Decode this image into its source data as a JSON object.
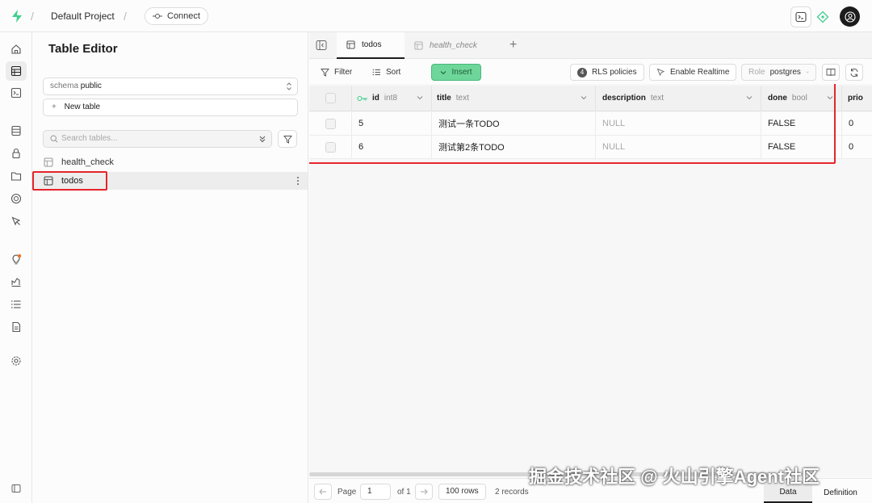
{
  "topbar": {
    "project_name": "Default Project",
    "connect_label": "Connect"
  },
  "sidebar": {
    "title": "Table Editor",
    "schema_prefix": "schema",
    "schema_value": "public",
    "new_table_label": "New table",
    "search_placeholder": "Search tables...",
    "tables": [
      {
        "name": "health_check",
        "selected": false
      },
      {
        "name": "todos",
        "selected": true
      }
    ]
  },
  "tabs": [
    {
      "label": "todos",
      "active": true
    },
    {
      "label": "health_check",
      "active": false
    }
  ],
  "toolbar": {
    "filter_label": "Filter",
    "sort_label": "Sort",
    "insert_label": "Insert",
    "rls_count": "4",
    "rls_label": "RLS policies",
    "realtime_label": "Enable Realtime",
    "role_prefix": "Role",
    "role_value": "postgres"
  },
  "grid": {
    "columns": [
      {
        "name": "id",
        "type": "int8"
      },
      {
        "name": "title",
        "type": "text"
      },
      {
        "name": "description",
        "type": "text"
      },
      {
        "name": "done",
        "type": "bool"
      },
      {
        "name": "prio",
        "type": ""
      }
    ],
    "rows": [
      {
        "id": "5",
        "title": "测试一条TODO",
        "description": "NULL",
        "done": "FALSE",
        "prio": "0"
      },
      {
        "id": "6",
        "title": "测试第2条TODO",
        "description": "NULL",
        "done": "FALSE",
        "prio": "0"
      }
    ]
  },
  "footer": {
    "page_label": "Page",
    "page_value": "1",
    "of_label": "of 1",
    "rows_label": "100 rows",
    "records_label": "2 records",
    "data_tab": "Data",
    "definition_tab": "Definition"
  },
  "watermark": "掘金技术社区 @ 火山引擎Agent社区",
  "colors": {
    "brand": "#3ecf8e",
    "insert_bg": "#6fd69a",
    "highlight_red": "#e5252a"
  }
}
